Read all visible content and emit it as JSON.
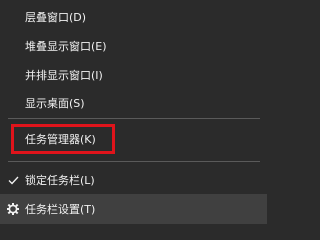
{
  "menu": {
    "items": [
      {
        "label": "层叠窗口(D)"
      },
      {
        "label": "堆叠显示窗口(E)"
      },
      {
        "label": "并排显示窗口(I)"
      },
      {
        "label": "显示桌面(S)"
      },
      {
        "label": "任务管理器(K)"
      },
      {
        "label": "锁定任务栏(L)",
        "icon": "checkmark-icon"
      },
      {
        "label": "任务栏设置(T)",
        "icon": "gear-icon"
      }
    ]
  },
  "colors": {
    "background": "#2b2b2b",
    "text": "#f2f2f2",
    "separator": "#5a5a5a",
    "highlight_border": "#e0141b",
    "hover": "#404040"
  }
}
